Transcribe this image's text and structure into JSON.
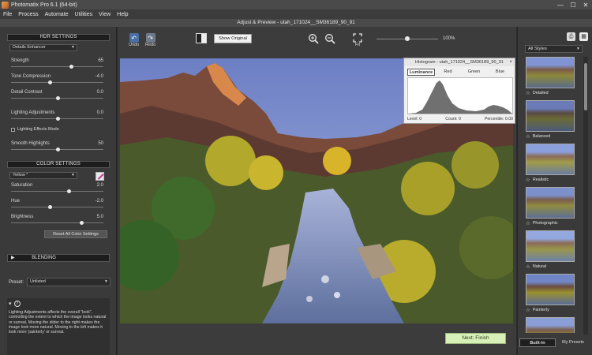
{
  "app": {
    "title": "Photomatix Pro 6.1 (64-bit)",
    "document_title": "Adjust & Preview - utah_171024__SM36189_90_91"
  },
  "window_controls": {
    "minimize": "—",
    "maximize": "☐",
    "close": "✕"
  },
  "menu": [
    "File",
    "Process",
    "Automate",
    "Utilities",
    "View",
    "Help"
  ],
  "hdr": {
    "header": "HDR SETTINGS",
    "method": "Details Enhancer",
    "sliders": [
      {
        "label": "Strength",
        "value": "65",
        "position": 0.65
      },
      {
        "label": "Tone Compression",
        "value": "-4.0",
        "position": 0.42
      },
      {
        "label": "Detail Contrast",
        "value": "0.0",
        "position": 0.5
      },
      {
        "label": "Lighting Adjustments",
        "value": "0.0",
        "position": 0.5
      }
    ],
    "checkbox": "Lighting Effects Mode",
    "smooth": {
      "label": "Smooth Highlights",
      "value": "50",
      "position": 0.5
    }
  },
  "color": {
    "header": "COLOR SETTINGS",
    "channel": "Yellow *",
    "sliders": [
      {
        "label": "Saturation",
        "value": "2.0",
        "position": 0.62
      },
      {
        "label": "Hue",
        "value": "-2.0",
        "position": 0.42
      },
      {
        "label": "Brightness",
        "value": "5.0",
        "position": 0.76
      }
    ],
    "reset": "Reset All Color Settings"
  },
  "blending": {
    "label": "BLENDING"
  },
  "preset": {
    "label": "Preset:",
    "value": "Unlisted"
  },
  "help": {
    "text": "Lighting Adjustments affects the overall \"look\", controlling the extent to which the image looks natural or surreal. Moving the slider to the right makes the image look more natural. Moving to the left makes it look more 'painterly' or surreal."
  },
  "toolbar": {
    "undo": "Undo",
    "redo": "Redo",
    "show_original": "Show Original",
    "fit": "Fit",
    "zoom_percent": "100%",
    "zoom_level": 0.5
  },
  "histogram": {
    "title": "Histogram - utah_171024__SM36189_90_91",
    "close": "×",
    "tabs": [
      "Luminance",
      "Red",
      "Green",
      "Blue"
    ],
    "level": "Level: 0",
    "count": "Count: 0",
    "percentile": "Percentile: 0.00"
  },
  "next": {
    "label": "Next: Finish"
  },
  "styles": {
    "dropdown": "All Styles",
    "items": [
      "Detailed",
      "Balanced",
      "Realistic",
      "Photographic",
      "Natural",
      "Painterly",
      ""
    ],
    "tabs": [
      "Built-In",
      "My Presets"
    ]
  },
  "colors": {
    "accent_green": "#d8f0b8",
    "panel": "#3a3a3a",
    "background": "#2b2b2b"
  }
}
